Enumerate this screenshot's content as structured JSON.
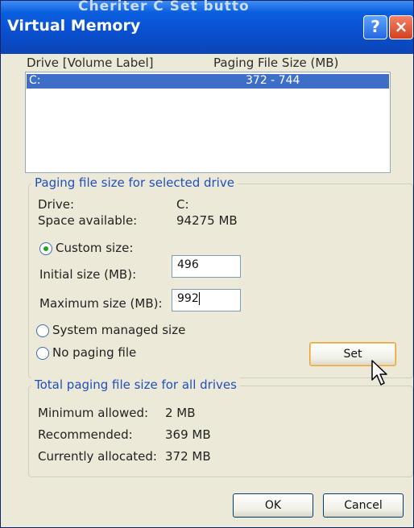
{
  "window": {
    "title": "Virtual Memory",
    "stray_top_text": "Cheriter C Set butto",
    "help_glyph": "?",
    "close_glyph": "×"
  },
  "drive_list": {
    "headers": {
      "drive": "Drive  [Volume Label]",
      "paging_size": "Paging File Size (MB)"
    },
    "rows": [
      {
        "drive": "C:",
        "paging_size": "372 - 744",
        "selected": true
      }
    ]
  },
  "selected_drive": {
    "legend": "Paging file size for selected drive",
    "drive_label": "Drive:",
    "drive_value": "C:",
    "space_label": "Space available:",
    "space_value": "94275 MB",
    "custom_size_label": "Custom size:",
    "initial_label": "Initial size (MB):",
    "initial_value": "496",
    "maximum_label": "Maximum size (MB):",
    "maximum_value": "992",
    "system_managed_label": "System managed size",
    "no_paging_label": "No paging file",
    "set_label": "Set",
    "selected_option": "custom"
  },
  "totals": {
    "legend": "Total paging file size for all drives",
    "min_label": "Minimum allowed:",
    "min_value": "2 MB",
    "recommended_label": "Recommended:",
    "recommended_value": "369 MB",
    "allocated_label": "Currently allocated:",
    "allocated_value": "372 MB"
  },
  "footer": {
    "ok_label": "OK",
    "cancel_label": "Cancel"
  },
  "icons": [
    "help-icon",
    "close-icon",
    "radio-icon",
    "mouse-pointer-icon"
  ],
  "colors": {
    "titlebar": "#0a4fd0",
    "selection": "#3e6fc8",
    "legend": "#1f4fbf",
    "dialog_bg": "#ece9d8"
  }
}
